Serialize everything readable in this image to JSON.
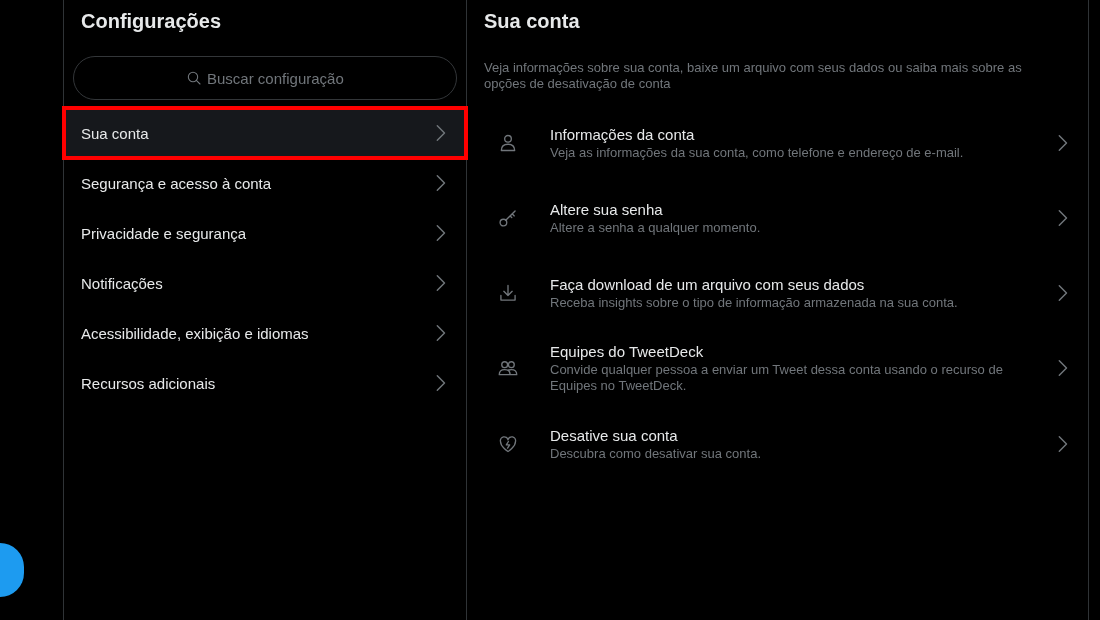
{
  "settings": {
    "title": "Configurações",
    "search": {
      "placeholder": "Buscar configuração"
    },
    "items": [
      {
        "label": "Sua conta",
        "selected": true,
        "highlighted": true
      },
      {
        "label": "Segurança e acesso à conta",
        "selected": false,
        "highlighted": false
      },
      {
        "label": "Privacidade e segurança",
        "selected": false,
        "highlighted": false
      },
      {
        "label": "Notificações",
        "selected": false,
        "highlighted": false
      },
      {
        "label": "Acessibilidade, exibição e idiomas",
        "selected": false,
        "highlighted": false
      },
      {
        "label": "Recursos adicionais",
        "selected": false,
        "highlighted": false
      }
    ]
  },
  "account": {
    "title": "Sua conta",
    "description": "Veja informações sobre sua conta, baixe um arquivo com seus dados ou saiba mais sobre as opções de desativação de conta",
    "options": [
      {
        "kind": "profile",
        "title": "Informações da conta",
        "description": "Veja as informações da sua conta, como telefone e endereço de e-mail."
      },
      {
        "kind": "password",
        "title": "Altere sua senha",
        "description": "Altere a senha a qualquer momento."
      },
      {
        "kind": "download",
        "title": "Faça download de um arquivo com seus dados",
        "description": "Receba insights sobre o tipo de informação armazenada na sua conta."
      },
      {
        "kind": "teams",
        "title": "Equipes do TweetDeck",
        "description": "Convide qualquer pessoa a enviar um Tweet dessa conta usando o recurso de Equipes no TweetDeck."
      },
      {
        "kind": "deactivate",
        "title": "Desative sua conta",
        "description": "Descubra como desativar sua conta."
      }
    ]
  }
}
